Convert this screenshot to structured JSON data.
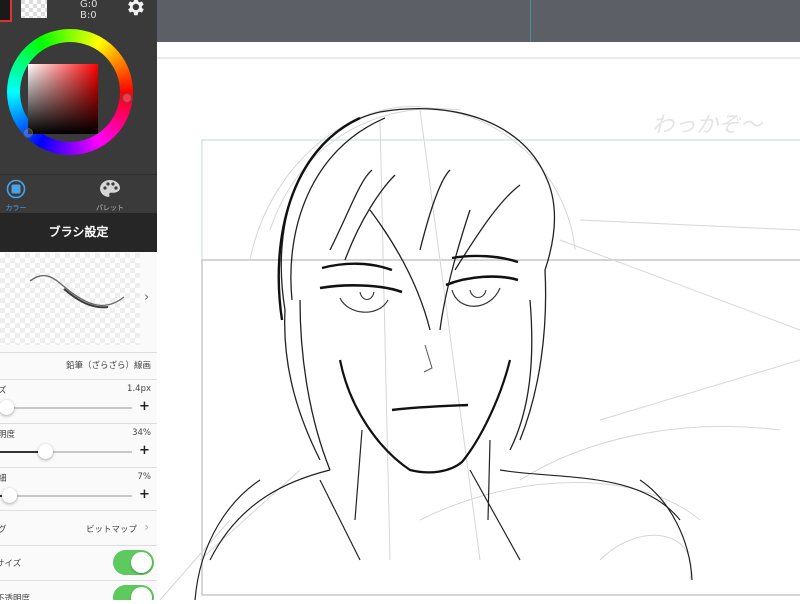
{
  "color_panel": {
    "rgb_g": "G:0",
    "rgb_b": "B:0",
    "colors": {
      "main": "#1a1a1a",
      "hue": "#ff0000"
    },
    "icons": {
      "settings": "gear-icon",
      "color_tab": "color-square-icon",
      "palette_tab": "palette-icon"
    }
  },
  "mode_tabs": [
    {
      "label": "カラー",
      "active": true
    },
    {
      "label": "パレット",
      "active": false
    }
  ],
  "brush_panel": {
    "title": "ブラシ設定",
    "brush_name": "鉛筆（ざらざら）線画",
    "size": {
      "label": "ズ",
      "value": "1.4px",
      "level": 0.03
    },
    "opacity": {
      "label": "明度",
      "value": "34%",
      "level": 0.34
    },
    "third": {
      "label": "細",
      "value": "7%",
      "level": 0.07
    },
    "type": {
      "label": "グ",
      "value": "ビットマップ"
    },
    "toggles": [
      {
        "label": "サイズ",
        "on": true
      },
      {
        "label": "不透明度",
        "on": true
      }
    ],
    "accent_color": "#5ec95e"
  },
  "canvas": {
    "scribble_text": "わっかぞ〜"
  }
}
